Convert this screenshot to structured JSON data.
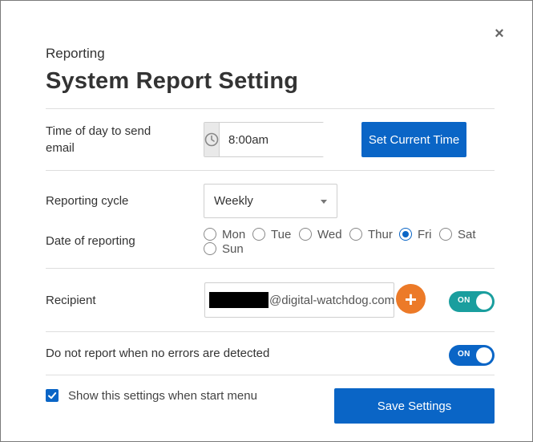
{
  "dialog": {
    "subtitle": "Reporting",
    "title": "System Report Setting",
    "close_icon": "close-icon"
  },
  "time_row": {
    "label": "Time of day to send email",
    "value": "8:00am",
    "icon": "clock-icon",
    "button_label": "Set Current Time"
  },
  "cycle_row": {
    "label": "Reporting cycle",
    "selected": "Weekly"
  },
  "date_row": {
    "label": "Date of reporting",
    "options": [
      {
        "label": "Mon",
        "checked": false
      },
      {
        "label": "Tue",
        "checked": false
      },
      {
        "label": "Wed",
        "checked": false
      },
      {
        "label": "Thur",
        "checked": false
      },
      {
        "label": "Fri",
        "checked": true
      },
      {
        "label": "Sat",
        "checked": false
      },
      {
        "label": "Sun",
        "checked": false
      }
    ]
  },
  "recipient_row": {
    "label": "Recipient",
    "email_domain": "@digital-watchdog.com",
    "add_icon": "plus-icon",
    "toggle_label": "ON",
    "toggle_color": "#1a9e9e"
  },
  "no_errors_row": {
    "label": "Do not report when no errors are detected",
    "toggle_label": "ON",
    "toggle_color": "#0a65c6"
  },
  "footer": {
    "checkbox_label": "Show this settings when start menu",
    "checkbox_checked": true,
    "save_label": "Save Settings"
  },
  "colors": {
    "primary": "#0a65c6",
    "accent_orange": "#ec7a28",
    "teal": "#1a9e9e"
  }
}
